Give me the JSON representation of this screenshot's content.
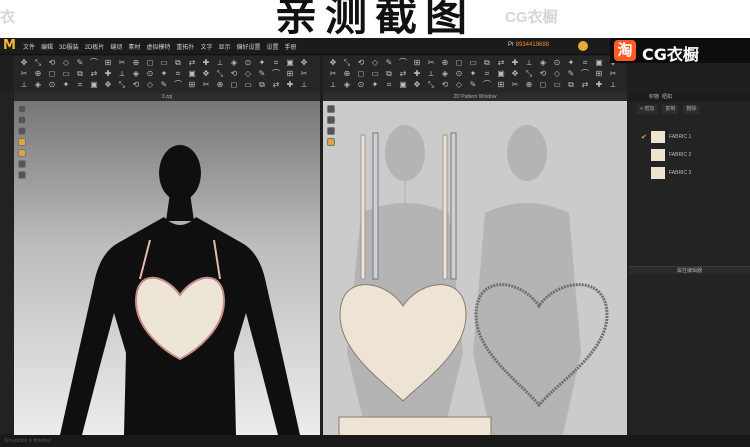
{
  "banner": {
    "title": "亲测截图",
    "watermark_left": "衣",
    "watermark_right": "CG衣橱"
  },
  "app": {
    "menus": [
      "文件",
      "编辑",
      "3D服装",
      "2D板片",
      "缝纫",
      "素材",
      "虚拟模特",
      "重拓扑",
      "文字",
      "显示",
      "偏好设置",
      "设置",
      "手册"
    ],
    "serial_label": "Pr",
    "serial_number": "8934419688",
    "badge_icon_char": "淘",
    "badge_text": "CG衣橱",
    "accent_color": "#e8a936"
  },
  "viewport3d": {
    "title": "3.zpj"
  },
  "viewport2d": {
    "title": "2D Pattern Window"
  },
  "object_browser": {
    "tabs": [
      "织物",
      "纽扣"
    ],
    "tools": [
      "+ 增加",
      "复制",
      "删除"
    ],
    "fabrics": [
      {
        "name": "FABRIC 1",
        "selected": true
      },
      {
        "name": "FABRIC 2",
        "selected": false
      },
      {
        "name": "FABRIC 3",
        "selected": false
      }
    ],
    "property_editor_label": "属性编辑器"
  },
  "statusbar": {
    "text": "Simulation is finished"
  }
}
